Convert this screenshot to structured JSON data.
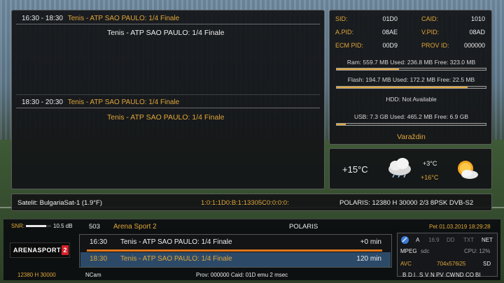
{
  "epg": {
    "items": [
      {
        "time": "16:30 - 18:30",
        "title": "Tenis - ATP SAO PAULO: 1/4 Finale",
        "description": "Tenis - ATP SAO PAULO: 1/4 Finale"
      },
      {
        "time": "18:30 - 20:30",
        "title": "Tenis - ATP SAO PAULO: 1/4 Finale",
        "description": "Tenis - ATP SAO PAULO: 1/4 Finale"
      }
    ]
  },
  "info": {
    "sid_label": "SID:",
    "sid": "01D0",
    "caid_label": "CAID:",
    "caid": "1010",
    "apid_label": "A.PID:",
    "apid": "08AE",
    "vpid_label": "V.PID:",
    "vpid": "08AD",
    "ecmpid_label": "ECM PID:",
    "ecmpid": "00D9",
    "provid_label": "PROV ID:",
    "provid": "000000",
    "ram": "Ram: 559.7 MB Used: 236.8 MB Free: 323.0 MB",
    "ram_fill": 0.42,
    "flash": "Flash: 194.7 MB Used: 172.2 MB Free: 22.5 MB",
    "flash_fill": 0.88,
    "hdd": "HDD: Not Available",
    "usb": "USB: 7.3 GB Used: 465.2 MB Free: 6.9 GB",
    "usb_fill": 0.06,
    "city": "Varaždin"
  },
  "weather": {
    "current": "+15°C",
    "low": "+3°C",
    "high": "+16°C"
  },
  "satbar": {
    "satellite": "Satelit: BulgariaSat-1 (1.9°F)",
    "service_ref": "1:0:1:1D0:B:1:13305C0:0:0:0:",
    "provider_info": "POLARIS: 12380 H 30000 2/3 8PSK DVB-S2"
  },
  "infobar": {
    "snr_label": "SNR:",
    "snr_value": "10.5 dB",
    "snr_fill": 0.8,
    "channel_number": "503",
    "channel_name": "Arena Sport 2",
    "provider": "POLARIS",
    "datetime": "Pet 01.03.2019  18:29:28",
    "logo_text": "ARENASPORT",
    "logo_number": "2",
    "programs": [
      {
        "time": "16:30",
        "title": "Tenis - ATP SAO PAULO: 1/4 Finale",
        "remaining": "+0 min"
      },
      {
        "time": "18:30",
        "title": "Tenis - ATP SAO PAULO: 1/4 Finale",
        "remaining": "120 min"
      }
    ],
    "program_progress": 1.0,
    "freq": "12380 H 30000",
    "cam": "NCam",
    "caid_info": "Prov: 000000  Caid: 01D emu  2 msec",
    "tech": {
      "badges": [
        "A",
        "16:9",
        "DD",
        "TXT",
        "NET"
      ],
      "codec_label": "MPEG",
      "codec_value": "sdc",
      "cpu": "CPU: 12%",
      "avc": "AVC",
      "resolution": "704x576i25",
      "sd": "SD",
      "cas": [
        "B",
        "D",
        "I",
        "S",
        "V",
        "N",
        "PV",
        "CW",
        "ND",
        "CO",
        "BI"
      ]
    }
  }
}
